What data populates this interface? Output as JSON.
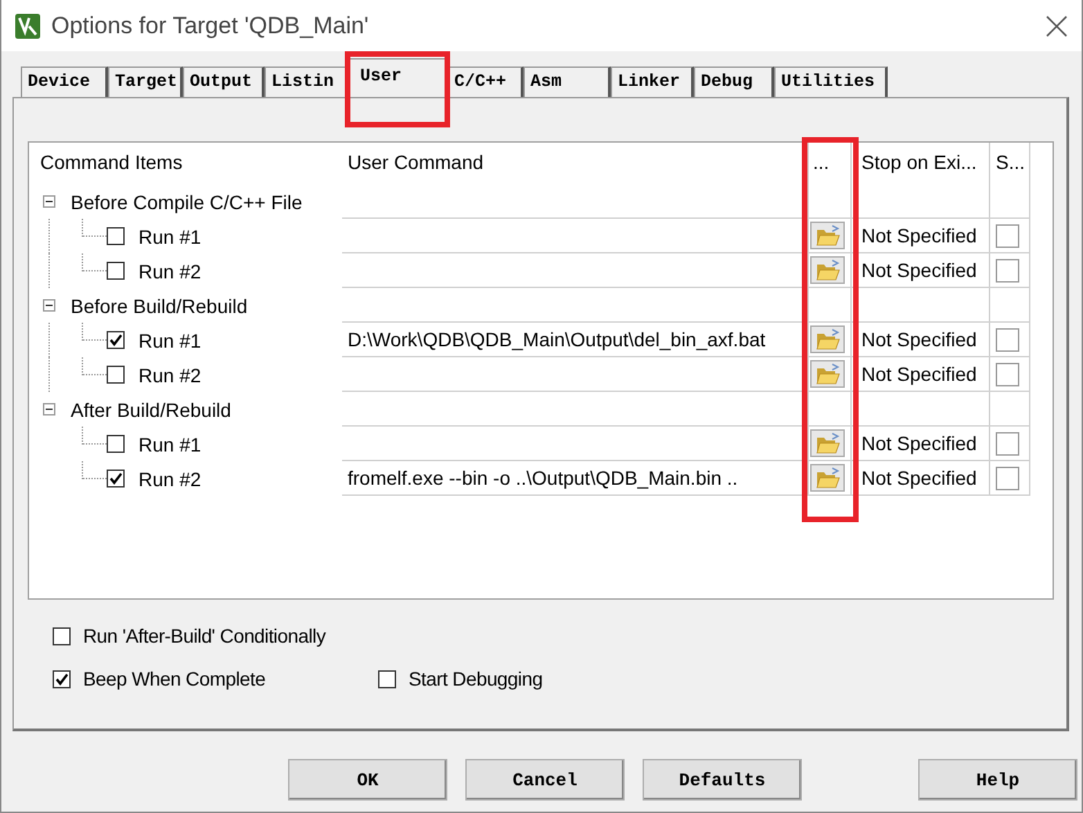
{
  "window": {
    "title": "Options for Target 'QDB_Main'"
  },
  "tabs": [
    {
      "label": "Device",
      "selected": false,
      "highlighted": false
    },
    {
      "label": "Target",
      "selected": false,
      "highlighted": false
    },
    {
      "label": "Output",
      "selected": false,
      "highlighted": false
    },
    {
      "label": "Listin",
      "selected": false,
      "highlighted": false
    },
    {
      "label": "User",
      "selected": true,
      "highlighted": true
    },
    {
      "label": "C/C++",
      "selected": false,
      "highlighted": false
    },
    {
      "label": "Asm",
      "selected": false,
      "highlighted": false
    },
    {
      "label": "Linker",
      "selected": false,
      "highlighted": false
    },
    {
      "label": "Debug",
      "selected": false,
      "highlighted": false
    },
    {
      "label": "Utilities",
      "selected": false,
      "highlighted": false
    }
  ],
  "table": {
    "columns": [
      {
        "label": "Command Items",
        "highlighted": false
      },
      {
        "label": "User Command",
        "highlighted": false
      },
      {
        "label": "...",
        "highlighted": true
      },
      {
        "label": "Stop on Exi...",
        "highlighted": false
      },
      {
        "label": "S...",
        "highlighted": false
      }
    ],
    "groups": [
      {
        "label": "Before Compile C/C++ File",
        "expanded": true,
        "children": [
          {
            "label": "Run #1",
            "checked": false,
            "stop": "Not Specified",
            "column_5_checked": false
          },
          {
            "label": "Run #2",
            "checked": false,
            "stop": "Not Specified",
            "column_5_checked": false
          }
        ]
      },
      {
        "label": "Before Build/Rebuild",
        "expanded": true,
        "children": [
          {
            "label": "Run #1",
            "checked": true,
            "command": "D:\\Work\\QDB\\QDB_Main\\Output\\del_bin_axf.bat",
            "stop": "Not Specified",
            "column_5_checked": false
          },
          {
            "label": "Run #2",
            "checked": false,
            "stop": "Not Specified",
            "column_5_checked": false
          }
        ]
      },
      {
        "label": "After Build/Rebuild",
        "expanded": true,
        "children": [
          {
            "label": "Run #1",
            "checked": false,
            "stop": "Not Specified",
            "column_5_checked": false
          },
          {
            "label": "Run #2",
            "checked": true,
            "command": "fromelf.exe  --bin -o  ..\\Output\\QDB_Main.bin  ..",
            "stop": "Not Specified",
            "column_5_checked": false
          }
        ]
      }
    ]
  },
  "options": [
    [
      {
        "label": "Run 'After-Build' Conditionally",
        "checked": false
      }
    ],
    [
      {
        "label": "Beep When Complete",
        "checked": true
      },
      {
        "label": "Start Debugging",
        "checked": false
      }
    ]
  ],
  "buttons": [
    "OK",
    "Cancel",
    "Defaults",
    "Help"
  ]
}
